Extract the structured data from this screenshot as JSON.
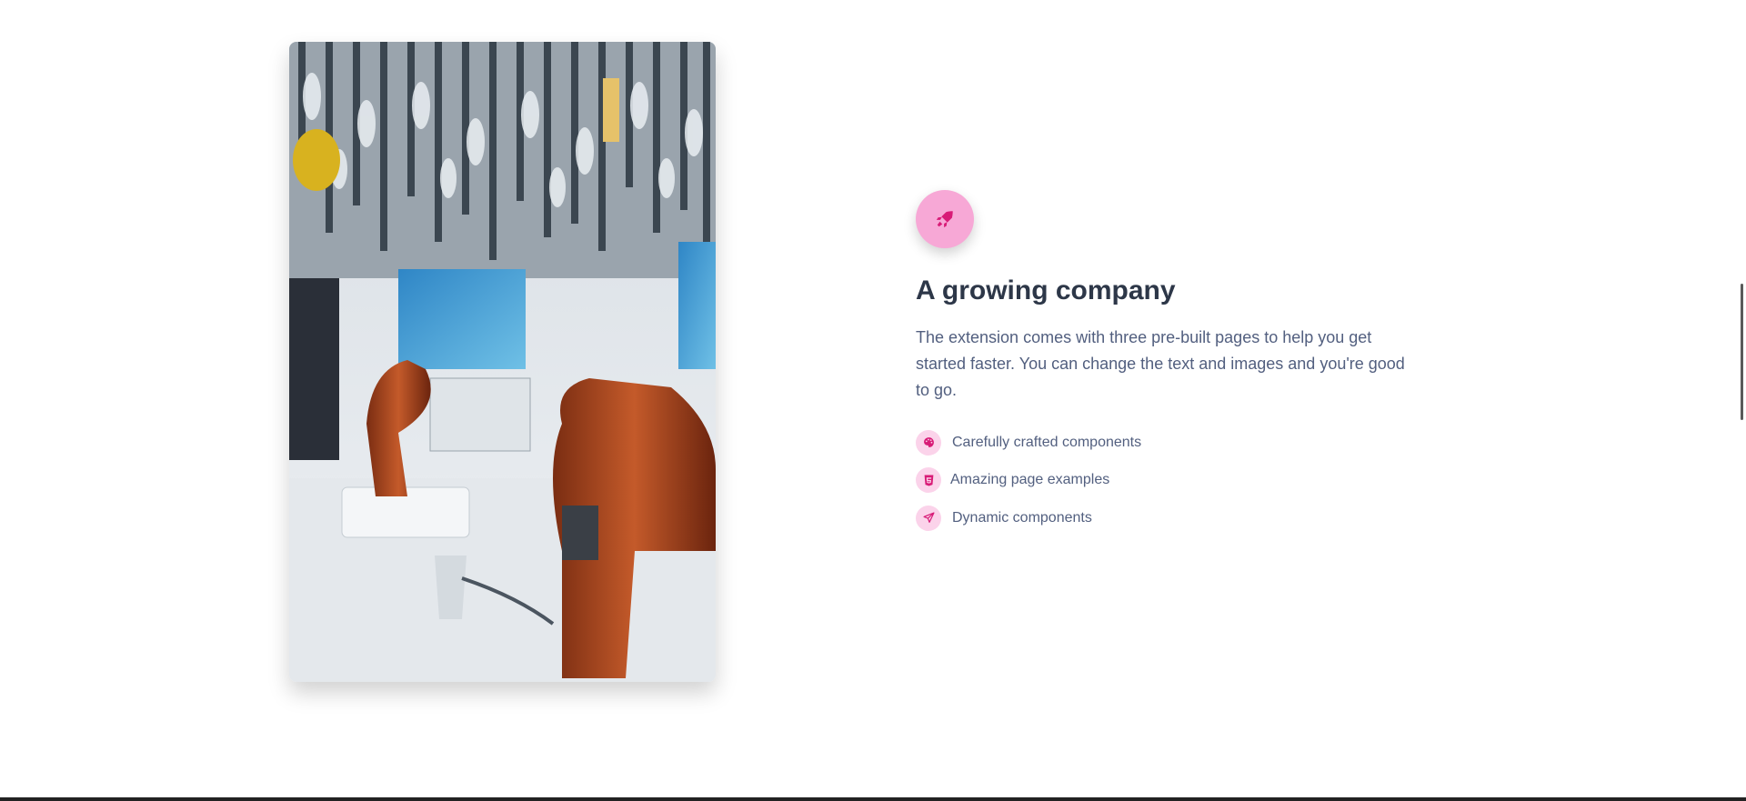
{
  "feature": {
    "icon": "rocket-icon",
    "heading": "A growing company",
    "description": "The extension comes with three pre-built pages to help you get started faster. You can change the text and images and you're good to go.",
    "items": [
      {
        "icon": "palette-icon",
        "label": "Carefully crafted components"
      },
      {
        "icon": "html5-icon",
        "label": "Amazing page examples"
      },
      {
        "icon": "paper-plane-icon",
        "label": "Dynamic components"
      }
    ]
  },
  "colors": {
    "accent": "#d81b77",
    "icon_bg": "#f7a8d6",
    "badge_bg": "#fbd3ea",
    "heading": "#2d3748",
    "text": "#525f7f"
  }
}
